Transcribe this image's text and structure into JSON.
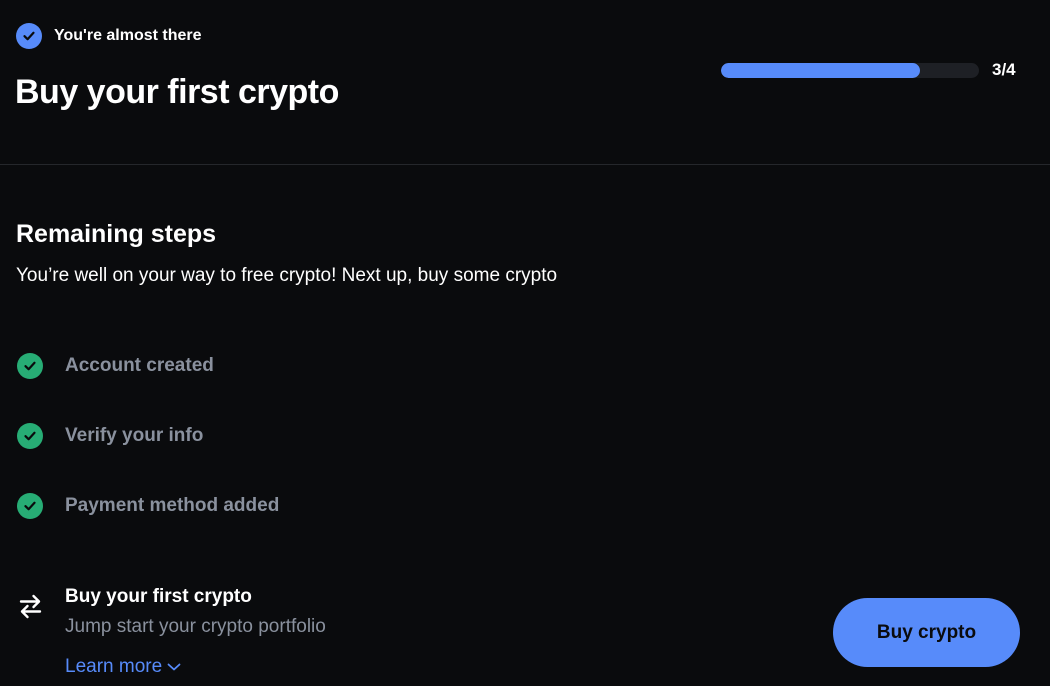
{
  "header": {
    "status_text": "You're almost there",
    "title": "Buy your first crypto",
    "progress": {
      "label": "3/4",
      "fraction": 0.77,
      "color": "#578bfa"
    }
  },
  "remaining": {
    "title": "Remaining steps",
    "subtitle": "You’re well on your way to free crypto! Next up, buy some crypto",
    "completed_steps": [
      {
        "label": "Account created",
        "icon": "check-circle-icon"
      },
      {
        "label": "Verify your info",
        "icon": "check-circle-icon"
      },
      {
        "label": "Payment method added",
        "icon": "check-circle-icon"
      }
    ],
    "current_step": {
      "icon": "swap-arrows-icon",
      "title": "Buy your first crypto",
      "description": "Jump start your crypto portfolio",
      "link_label": "Learn more"
    }
  },
  "actions": {
    "buy_label": "Buy crypto"
  },
  "colors": {
    "background": "#0a0b0d",
    "accent": "#578bfa",
    "success": "#27ad75",
    "muted_text": "#8a919e"
  }
}
